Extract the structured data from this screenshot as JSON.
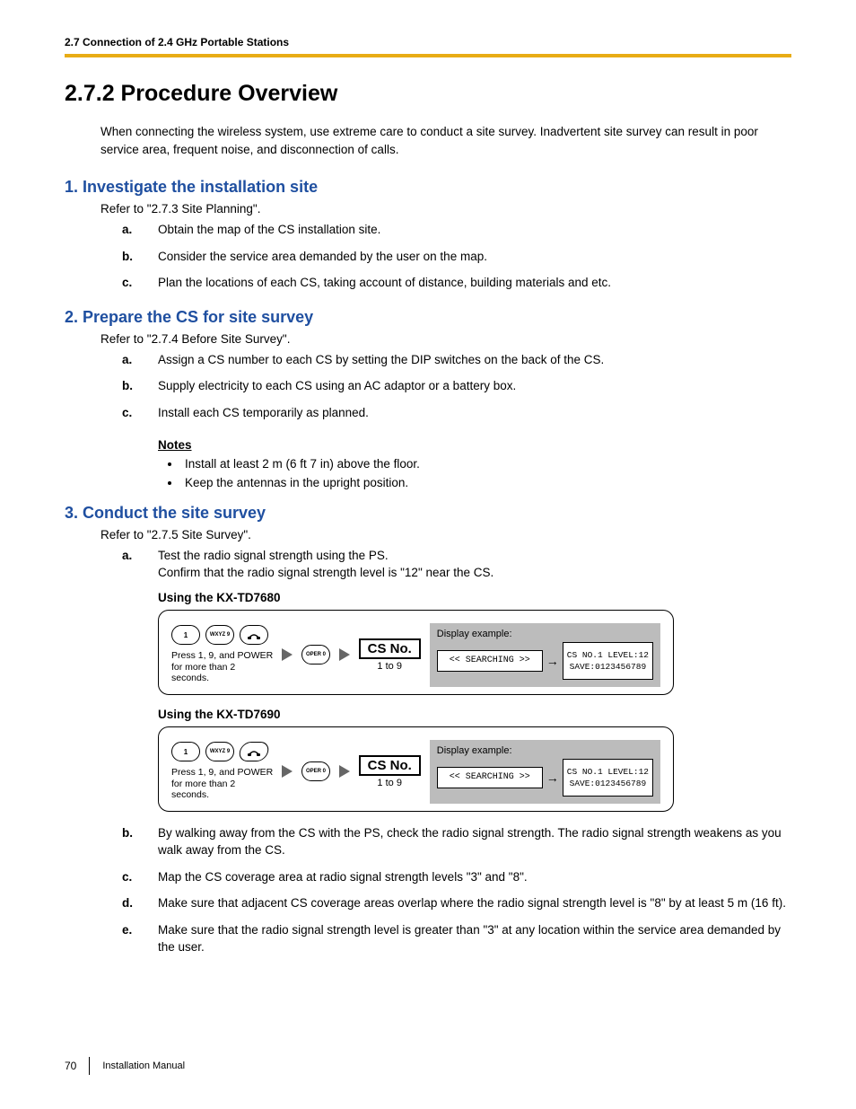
{
  "header": {
    "running": "2.7 Connection of 2.4 GHz Portable Stations"
  },
  "title": "2.7.2    Procedure Overview",
  "intro": "When connecting the wireless system, use extreme care to conduct a site survey. Inadvertent site survey can result in poor service area, frequent noise, and disconnection of calls.",
  "sections": [
    {
      "title": "1. Investigate the installation site",
      "refer": "Refer to \"2.7.3 Site Planning\".",
      "items": [
        "Obtain the map of the CS installation site.",
        "Consider the service area demanded by the user on the map.",
        "Plan the locations of each CS, taking account of distance, building materials and etc."
      ]
    },
    {
      "title": "2. Prepare the CS for site survey",
      "refer": "Refer to \"2.7.4 Before Site Survey\".",
      "items": [
        "Assign a CS number to each CS by setting the DIP switches on the back of the CS.",
        "Supply electricity to each CS using an AC adaptor or a battery box.",
        "Install each CS temporarily as planned."
      ],
      "notes_head": "Notes",
      "notes": [
        "Install at least 2 m (6 ft 7 in) above the floor.",
        "Keep the antennas in the upright position."
      ]
    },
    {
      "title": "3. Conduct the site survey",
      "refer": "Refer to \"2.7.5 Site Survey\".",
      "a_lines": [
        "Test the radio signal strength using the PS.",
        "Confirm that the radio signal strength level is \"12\" near the CS."
      ],
      "devices": [
        {
          "heading": "Using the KX-TD7680",
          "btn_style": "round"
        },
        {
          "heading": "Using the KX-TD7690",
          "btn_style": "slant"
        }
      ],
      "diagram": {
        "keys": [
          "1",
          "9",
          "POWER"
        ],
        "press": [
          "Press 1, 9, and POWER",
          "for more than 2 seconds."
        ],
        "csno": "CS No.",
        "csno_sub": "1 to 9",
        "display_label": "Display example:",
        "lcd_search": "<< SEARCHING >>",
        "lcd_line1": "CS NO.1 LEVEL:12",
        "lcd_line2": "SAVE:0123456789"
      },
      "rest": [
        "By walking away from the CS with the PS, check the radio signal strength. The radio signal strength weakens as you walk away from the CS.",
        "Map the CS coverage area at radio signal strength levels \"3\" and \"8\".",
        "Make sure that adjacent CS coverage areas overlap where the radio signal strength level is \"8\" by at least 5 m (16 ft).",
        "Make sure that the radio signal strength level is greater than \"3\" at any location within the service area demanded by the user."
      ]
    }
  ],
  "footer": {
    "page": "70",
    "doc": "Installation Manual"
  }
}
